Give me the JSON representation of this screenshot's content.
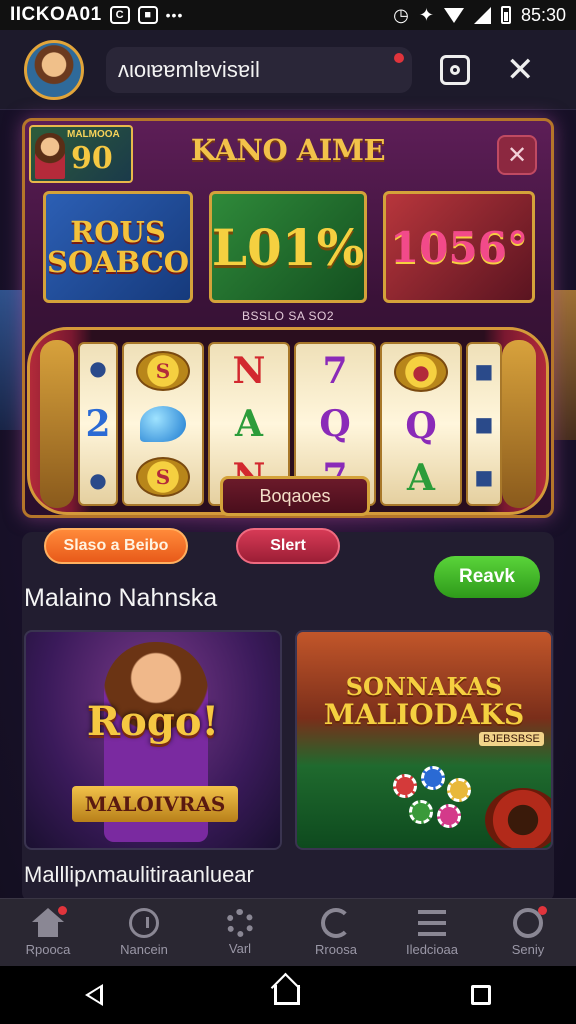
{
  "status_bar": {
    "left_text": "IICKOA01",
    "right_text": "85:30",
    "icons": [
      "notification-icon",
      "image-icon",
      "more-dots-icon",
      "alarm-icon",
      "bluetooth-icon",
      "vibrate-icon",
      "wifi-icon",
      "signal-icon",
      "battery-icon"
    ]
  },
  "header": {
    "search_text": "ʌιoιɐɐmlɐvisɐil",
    "avatar": "avatar",
    "action_icon": "camera-icon",
    "close_symbol": "✕"
  },
  "panel": {
    "logo_text": "MALMOOA",
    "logo_number": "90",
    "title": "KANO AIME",
    "close_symbol": "✕",
    "promos": [
      {
        "text": "ROUS SOABCO"
      },
      {
        "text": "L01%"
      },
      {
        "text": "1056°"
      }
    ],
    "subtitle": "BSSLO SA SO2",
    "reel_button": "Boqaoes"
  },
  "reels": [
    [
      "●",
      "2",
      "●"
    ],
    [
      "S",
      "◆",
      "S"
    ],
    [
      "N",
      "A",
      "N"
    ],
    [
      "7",
      "Q",
      "7"
    ],
    [
      "●",
      "Q",
      "A"
    ],
    [
      "■",
      "■",
      "■"
    ]
  ],
  "buttons": {
    "orange": "Slaso a Beibo",
    "red": "Slert",
    "green": "Reavk"
  },
  "section": {
    "title": "Malaino Nahnska",
    "bottom_label": "Malllipʌmaulitiraanluear"
  },
  "cards": [
    {
      "title": "Rogo!",
      "banner": "MALOIVRAS"
    },
    {
      "title_top": "SONNAKAS",
      "title_bottom": "MALIODAKS",
      "tag": "BJEBSBSE"
    }
  ],
  "tabs": [
    {
      "label": "Rpooca",
      "icon": "home-icon"
    },
    {
      "label": "Nancein",
      "icon": "clock-icon"
    },
    {
      "label": "Varl",
      "icon": "gear-icon"
    },
    {
      "label": "Rroosa",
      "icon": "refresh-icon"
    },
    {
      "label": "Iledcioaa",
      "icon": "list-icon"
    },
    {
      "label": "Seniy",
      "icon": "profile-icon"
    }
  ],
  "colors": {
    "accent_gold": "#f2c24a",
    "brand_purple": "#5d1e57",
    "green_button": "#5ad43a",
    "orange_button": "#ff8a3a",
    "red_button": "#d63a56"
  }
}
